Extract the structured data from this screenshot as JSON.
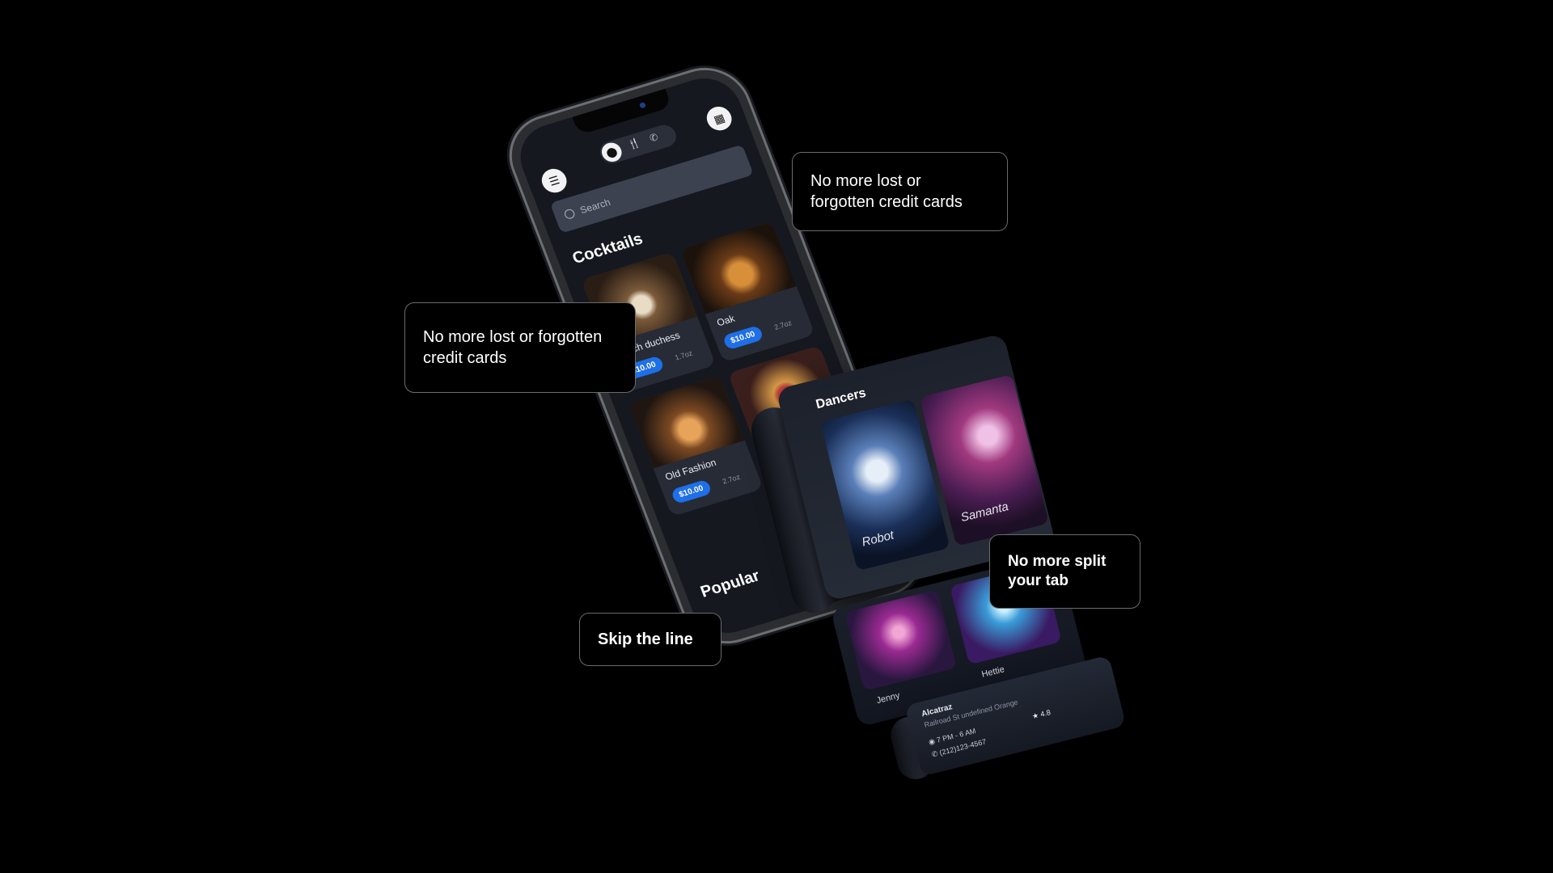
{
  "phone": {
    "search_placeholder": "Search",
    "sections": {
      "cocktails_title": "Cocktails",
      "popular_title": "Popular"
    },
    "cocktails": [
      {
        "name": "Dutch duchess",
        "price": "$10.00",
        "size": "1.7oz"
      },
      {
        "name": "Oak",
        "price": "$10.00",
        "size": "2.7oz"
      },
      {
        "name": "Old Fashion",
        "price": "$10.00",
        "size": "2.7oz"
      },
      {
        "name": "",
        "price": "",
        "size": ""
      }
    ]
  },
  "ribbon": {
    "dancers_title": "Dancers",
    "dancers": [
      {
        "name": "Robot"
      },
      {
        "name": "Samanta"
      }
    ],
    "lower": [
      {
        "name": "Jenny"
      },
      {
        "name": "Hettie"
      }
    ],
    "venue": {
      "name": "Alcatraz",
      "address": "Railroad St undefined Orange",
      "hours": "7 PM - 6 AM",
      "phone": "(212)123-4567",
      "rating": "4.8"
    }
  },
  "callouts": {
    "top_right": "No more lost or forgotten credit cards",
    "left": "No more lost or forgotten credit cards",
    "split_tab": "No more split your tab",
    "skip_line": "Skip the line"
  },
  "colors": {
    "background": "#000000",
    "accent_price": "#1e6fe8",
    "card_bg": "#262b36"
  },
  "icons": [
    "menu-icon",
    "location-icon",
    "restaurant-icon",
    "phone-icon",
    "qr-code-icon",
    "search-icon",
    "star-icon",
    "clock-icon"
  ]
}
